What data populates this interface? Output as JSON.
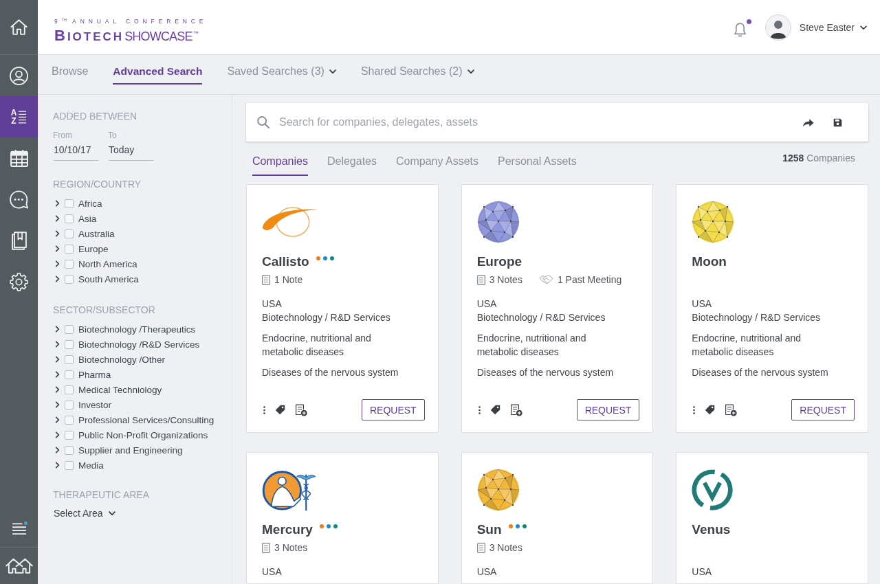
{
  "nav_top": [
    {
      "kind": "home",
      "selected": false
    },
    {
      "kind": "profile",
      "selected": false
    },
    {
      "kind": "sort",
      "selected": true,
      "letters": [
        "A",
        "Z"
      ]
    },
    {
      "kind": "calendar",
      "selected": false
    },
    {
      "kind": "chat",
      "selected": false
    },
    {
      "kind": "book",
      "selected": false
    },
    {
      "kind": "settings",
      "selected": false
    }
  ],
  "nav_bottom": [
    {
      "kind": "menu",
      "selected": false,
      "badge": true
    },
    {
      "kind": "houses",
      "selected": false
    }
  ],
  "header": {
    "logo": {
      "tagline": "9$^{TH}$ ANNUAL CONFERENCE",
      "name_bold": "BIOTECH",
      "name_light": "SHOWCASE$^{™}$"
    },
    "notifications": {
      "unread": true
    },
    "user": {
      "name": "Steve Easter"
    }
  },
  "tabs": [
    {
      "label": "Browse",
      "selected": false,
      "dropdown": false
    },
    {
      "label": "Advanced Search",
      "selected": true,
      "dropdown": false
    },
    {
      "label": "Saved Searches (3)",
      "selected": false,
      "dropdown": true
    },
    {
      "label": "Shared Searches (2)",
      "selected": false,
      "dropdown": true
    }
  ],
  "filters": {
    "date_range": {
      "title": "ADDED BETWEEN",
      "from": {
        "label": "From",
        "value": "10/10/17"
      },
      "to": {
        "label": "To",
        "value": "Today"
      }
    },
    "groups": [
      {
        "title": "REGION/COUNTRY",
        "items": [
          {
            "label": "Africa",
            "checked": false,
            "expanded": false
          },
          {
            "label": "Asia",
            "checked": false,
            "expanded": false
          },
          {
            "label": "Australia",
            "checked": false,
            "expanded": false
          },
          {
            "label": "Europe",
            "checked": false,
            "expanded": false
          },
          {
            "label": "North America",
            "checked": false,
            "expanded": false
          },
          {
            "label": "South America",
            "checked": false,
            "expanded": false
          }
        ]
      },
      {
        "title": "SECTOR/SUBSECTOR",
        "items": [
          {
            "label": "Biotechnology /Therapeutics",
            "checked": false,
            "expanded": false
          },
          {
            "label": "Biotechnology /R&D Services",
            "checked": false,
            "expanded": false
          },
          {
            "label": "Biotechnology /Other",
            "checked": false,
            "expanded": false
          },
          {
            "label": "Pharma",
            "checked": false,
            "expanded": false
          },
          {
            "label": "Medical Techniology",
            "checked": false,
            "expanded": false
          },
          {
            "label": "Investor",
            "checked": false,
            "expanded": false
          },
          {
            "label": "Professional Services/Consulting",
            "checked": false,
            "expanded": false
          },
          {
            "label": "Public Non-Profit Organizations",
            "checked": false,
            "expanded": false
          },
          {
            "label": "Supplier and Engineering",
            "checked": false,
            "expanded": false
          },
          {
            "label": "Media",
            "checked": false,
            "expanded": false
          }
        ]
      }
    ],
    "therapeutic_area": {
      "title": "THERAPEUTIC AREA",
      "value": "Select Area"
    }
  },
  "search": {
    "placeholder": "Search for companies, delegates, assets"
  },
  "result_tabs": [
    {
      "label": "Companies",
      "selected": true
    },
    {
      "label": "Delegates",
      "selected": false
    },
    {
      "label": "Company Assets",
      "selected": false
    },
    {
      "label": "Personal Assets",
      "selected": false
    }
  ],
  "result_count": "**1258** Companies",
  "cards": [
    {
      "name": "Callisto",
      "logo": {
        "kind": "swoosh",
        "color": "#f08a12"
      },
      "tags": [
        {
          "color": "#ee7c12"
        },
        {
          "color": "#1e8bc9"
        },
        {
          "color": "#0f8a78"
        }
      ],
      "notes": "1 Note",
      "country": "USA",
      "sector": "Biotechnology / R&D Services",
      "areas": [
        "Endocrine, nutritional and metabolic diseases",
        "Diseases of the nervous system"
      ],
      "action": "REQUEST"
    },
    {
      "name": "Europe",
      "logo": {
        "kind": "sphere",
        "color": "#8f98de"
      },
      "notes": "3 Notes",
      "meetings": "1 Past Meeting",
      "country": "USA",
      "sector": "Biotechnology / R&D Services",
      "areas": [
        "Endocrine, nutritional and metabolic diseases",
        "Diseases of the nervous system"
      ],
      "action": "REQUEST"
    },
    {
      "name": "Moon",
      "logo": {
        "kind": "sphere",
        "color": "#f3dc4a"
      },
      "country": "USA",
      "sector": "Biotechnology / R&D Services",
      "areas": [
        "Endocrine, nutritional and metabolic diseases",
        "Diseases of the nervous system"
      ],
      "action": "REQUEST"
    },
    {
      "name": "Mercury",
      "logo": {
        "kind": "emblem",
        "color": "#f29a33"
      },
      "tags": [
        {
          "color": "#ee7c12"
        },
        {
          "color": "#1e8bc9"
        },
        {
          "color": "#0f8a78"
        }
      ],
      "notes": "3 Notes",
      "country": "USA"
    },
    {
      "name": "Sun",
      "logo": {
        "kind": "sphere",
        "color": "#f2b83a"
      },
      "tags": [
        {
          "color": "#ee7c12"
        },
        {
          "color": "#1e8bc9"
        },
        {
          "color": "#0f8a78"
        }
      ],
      "notes": "3 Notes",
      "country": "USA"
    },
    {
      "name": "Venus",
      "logo": {
        "kind": "ring",
        "color": "#1f7a78"
      },
      "country": "USA"
    }
  ]
}
